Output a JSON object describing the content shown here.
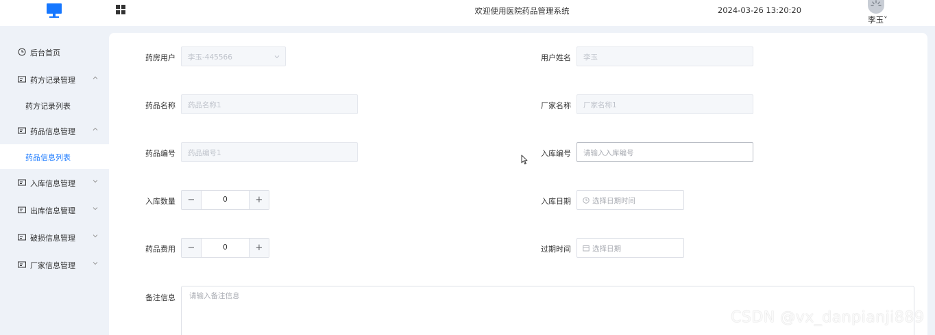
{
  "header": {
    "title": "欢迎使用医院药品管理系统",
    "datetime": "2024-03-26 13:20:20",
    "user_name": "李玉˅",
    "logo_icon": "monitor-icon",
    "apps_icon": "grid-icon",
    "brand_color": "#1677ff"
  },
  "sidebar": {
    "items": [
      {
        "label": "后台首页",
        "icon": "clock-icon"
      },
      {
        "label": "药方记录管理",
        "icon": "card-icon",
        "expanded": true,
        "children": [
          {
            "label": "药方记录列表"
          }
        ]
      },
      {
        "label": "药品信息管理",
        "icon": "card-icon",
        "expanded": true,
        "children": [
          {
            "label": "药品信息列表",
            "active": true
          }
        ]
      },
      {
        "label": "入库信息管理",
        "icon": "card-icon",
        "expanded": false
      },
      {
        "label": "出库信息管理",
        "icon": "card-icon",
        "expanded": false
      },
      {
        "label": "破损信息管理",
        "icon": "card-icon",
        "expanded": false
      },
      {
        "label": "厂家信息管理",
        "icon": "card-icon",
        "expanded": false
      }
    ]
  },
  "form": {
    "pharmacy_user": {
      "label": "药房用户",
      "value": "李玉-445566"
    },
    "user_name": {
      "label": "用户姓名",
      "value": "李玉"
    },
    "drug_name": {
      "label": "药品名称",
      "value": "药品名称1"
    },
    "manufacturer": {
      "label": "厂家名称",
      "value": "厂家名称1"
    },
    "drug_code": {
      "label": "药品编号",
      "value": "药品编号1"
    },
    "stock_in_code": {
      "label": "入库编号",
      "placeholder": "请输入入库编号"
    },
    "stock_in_qty": {
      "label": "入库数量",
      "value": "0",
      "minus": "−",
      "plus": "+"
    },
    "stock_in_date": {
      "label": "入库日期",
      "placeholder": "选择日期时间"
    },
    "drug_fee": {
      "label": "药品费用",
      "value": "0",
      "minus": "−",
      "plus": "+"
    },
    "expiry_time": {
      "label": "过期时间",
      "placeholder": "选择日期"
    },
    "remark": {
      "label": "备注信息",
      "placeholder": "请输入备注信息"
    }
  },
  "watermark": "CSDN @vx_danpianji889"
}
